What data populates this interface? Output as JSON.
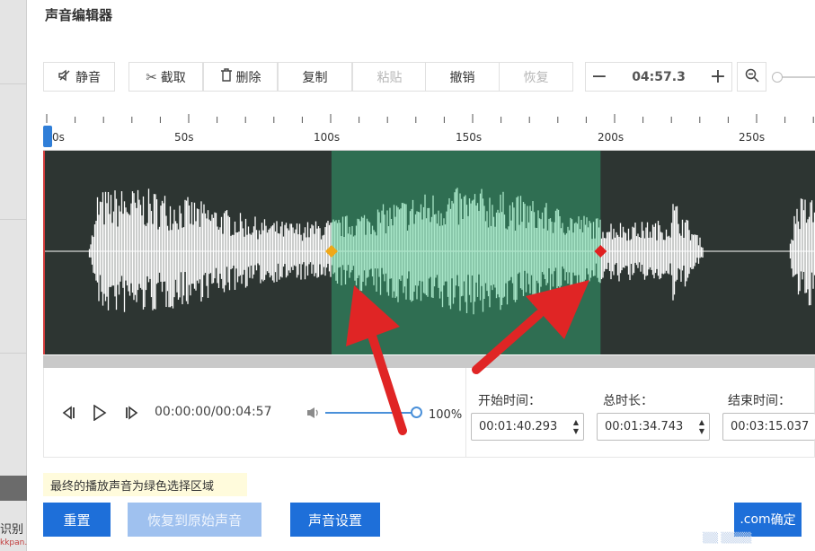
{
  "background_panel": {
    "left_text": "识别",
    "watermark": "kkpan.com"
  },
  "dialog": {
    "title": "声音编辑器"
  },
  "toolbar": {
    "mute_label": "静音",
    "cut_label": "截取",
    "delete_label": "删除",
    "copy_label": "复制",
    "paste_label": "粘贴",
    "undo_label": "撤销",
    "redo_label": "恢复",
    "minus_symbol": "−",
    "plus_symbol": "+",
    "time_value": "04:57.3"
  },
  "ruler": {
    "labels": [
      "0s",
      "50s",
      "100s",
      "150s",
      "200s",
      "250s"
    ]
  },
  "selection": {
    "start_seconds": 100.293,
    "end_seconds": 195.037,
    "fill_color": "#2f6e52",
    "wave_selected_color": "#a8e6c8",
    "start_marker_color": "#f0a818",
    "end_marker_color": "#e02020"
  },
  "player": {
    "time_display": "00:00:00/00:04:57",
    "volume_percent": "100%"
  },
  "fields": {
    "start_label": "开始时间：",
    "start_value": "00:01:40.293",
    "duration_label": "总时长：",
    "duration_value": "00:01:34.743",
    "end_label": "结束时间：",
    "end_value": "00:03:15.037"
  },
  "note": "最终的播放声音为绿色选择区域",
  "buttons": {
    "reset": "重置",
    "restore": "恢复到原始声音",
    "settings": "声音设置",
    "confirm": "确定",
    "confirm_overlay": ".com"
  },
  "colors": {
    "primary": "#1e6fd9",
    "wave_bg": "#2d3532",
    "arrow": "#e02525"
  }
}
